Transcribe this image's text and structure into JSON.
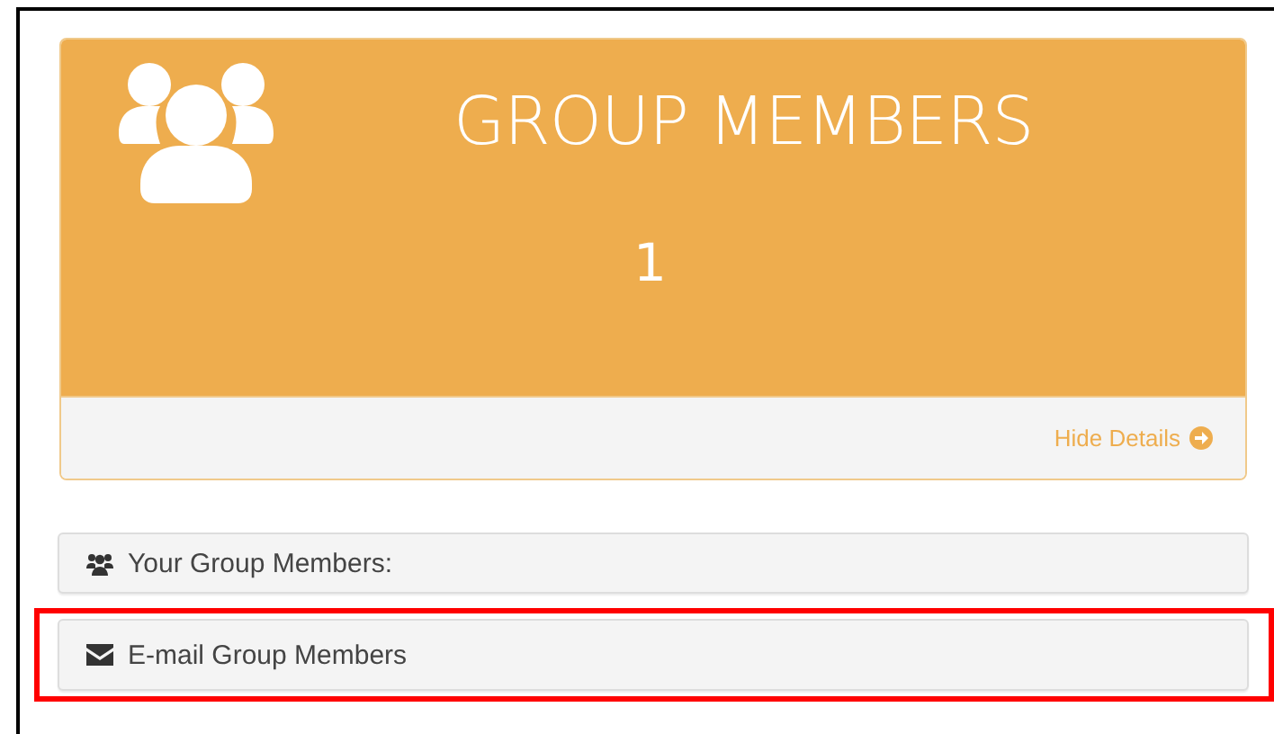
{
  "panel": {
    "title": "GROUP MEMBERS",
    "count": "1",
    "footer_link": "Hide Details"
  },
  "items": [
    {
      "kind": "members",
      "label": "Your Group Members:",
      "highlighted": false
    },
    {
      "kind": "email",
      "label": "E-mail Group Members",
      "highlighted": true
    }
  ]
}
